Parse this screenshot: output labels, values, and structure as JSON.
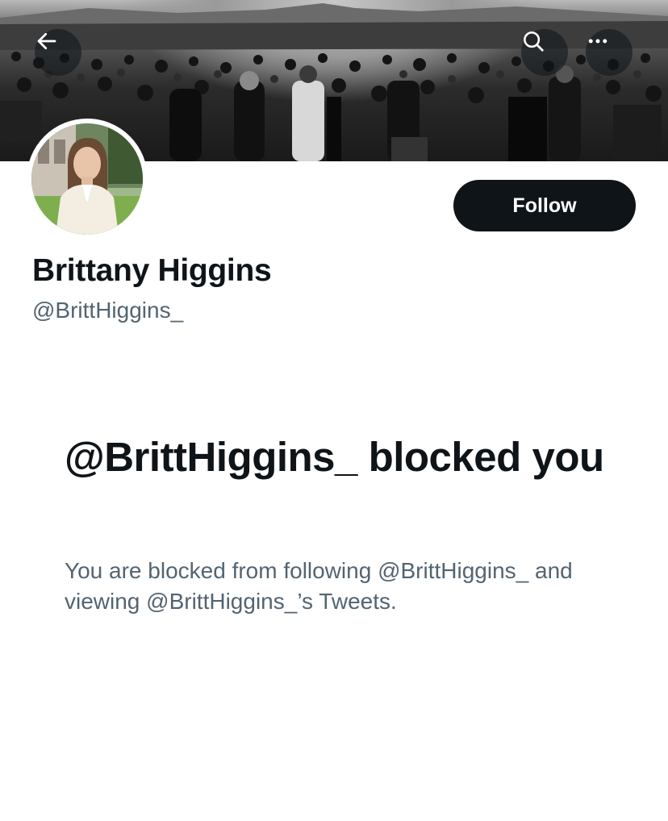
{
  "header": {
    "banner_image": "protest-crowd-photo",
    "back_icon": "arrow-left-icon",
    "search_icon": "search-icon",
    "more_icon": "more-options-icon"
  },
  "profile": {
    "avatar_image": "profile-photo",
    "display_name": "Brittany Higgins",
    "handle": "@BrittHiggins_",
    "follow_label": "Follow"
  },
  "blocked_notice": {
    "title": "@BrittHiggins_ blocked you",
    "description": "You are blocked from following @BrittHiggins_ and viewing @BrittHiggins_’s Tweets."
  },
  "colors": {
    "primary_text": "#0f1419",
    "secondary_text": "#536471",
    "follow_button_bg": "#0f1419",
    "follow_button_text": "#ffffff"
  }
}
